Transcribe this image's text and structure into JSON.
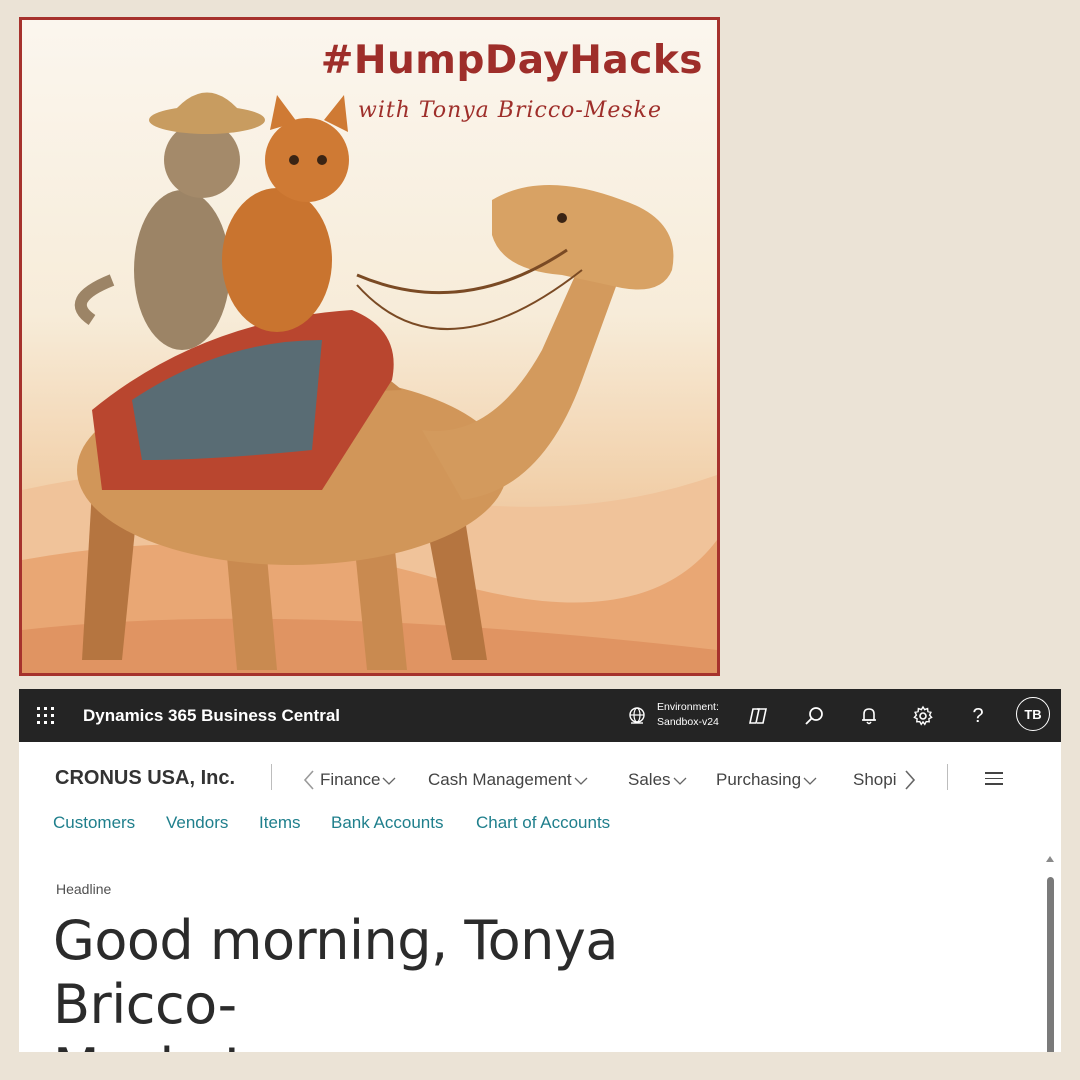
{
  "promo": {
    "title": "#HumpDayHacks",
    "subtitle": "with Tonya Bricco-Meske",
    "colors": {
      "frame": "#a6322d",
      "text": "#9e2e2a"
    }
  },
  "topbar": {
    "app_name": "Dynamics 365 Business Central",
    "environment_label": "Environment:",
    "environment_value": "Sandbox-v24",
    "icons": [
      "waffle-icon",
      "globe-icon",
      "copilot-icon",
      "search-icon",
      "bell-icon",
      "gear-icon",
      "help-icon"
    ],
    "help_glyph": "?",
    "avatar_initials": "TB"
  },
  "nav": {
    "company": "CRONUS USA, Inc.",
    "menu": [
      {
        "label": "Finance"
      },
      {
        "label": "Cash Management"
      },
      {
        "label": "Sales"
      },
      {
        "label": "Purchasing"
      },
      {
        "label": "Shopi"
      }
    ],
    "links": [
      "Customers",
      "Vendors",
      "Items",
      "Bank Accounts",
      "Chart of Accounts"
    ]
  },
  "headline": {
    "label": "Headline",
    "greeting_line1": "Good morning, Tonya Bricco-",
    "greeting_line2": "Meske!"
  },
  "colors": {
    "topbar": "#242424",
    "link": "#1f7f8c",
    "background": "#ebe3d6"
  }
}
